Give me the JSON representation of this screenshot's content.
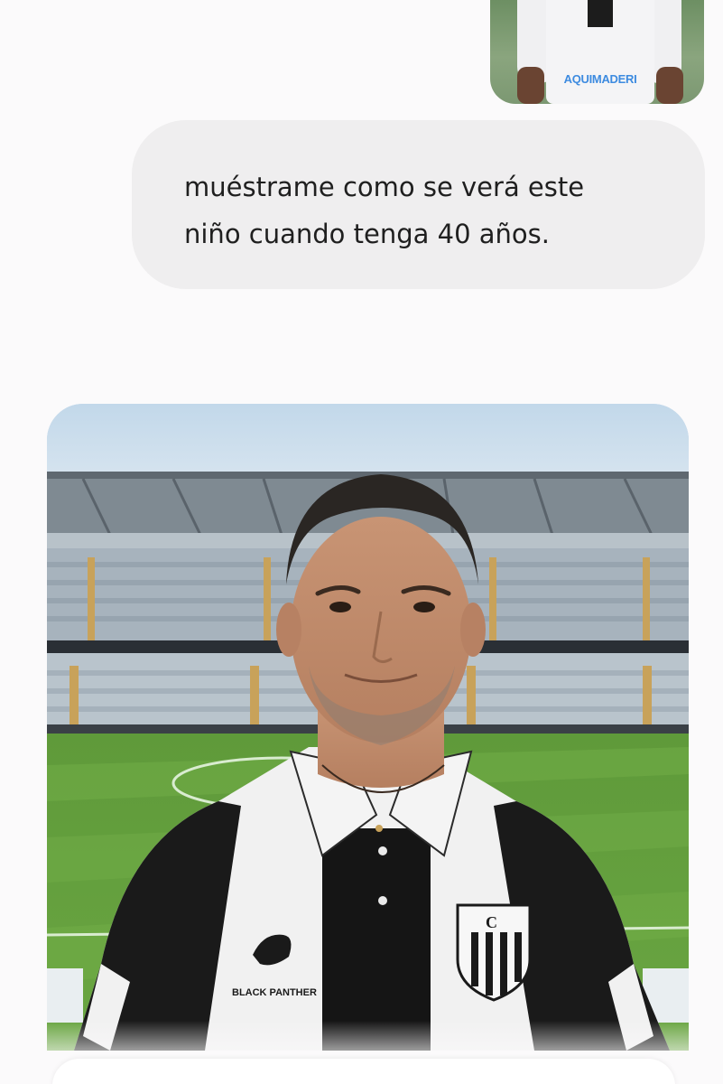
{
  "conversation": {
    "attachment": {
      "shirt_text": "AQUIMADERI"
    },
    "user_message": {
      "text": "muéstrame como se verá este\nniño cuando tenga 40 años."
    },
    "generated_image": {
      "jersey_brand": "BLACK PANTHER",
      "crest_initials": "C"
    }
  },
  "colors": {
    "page_bg": "#fbfafb",
    "bubble_bg": "#efeeef",
    "text": "#1f1f1f",
    "pitch": "#5f9a3a",
    "sky": "#c6dbea"
  }
}
